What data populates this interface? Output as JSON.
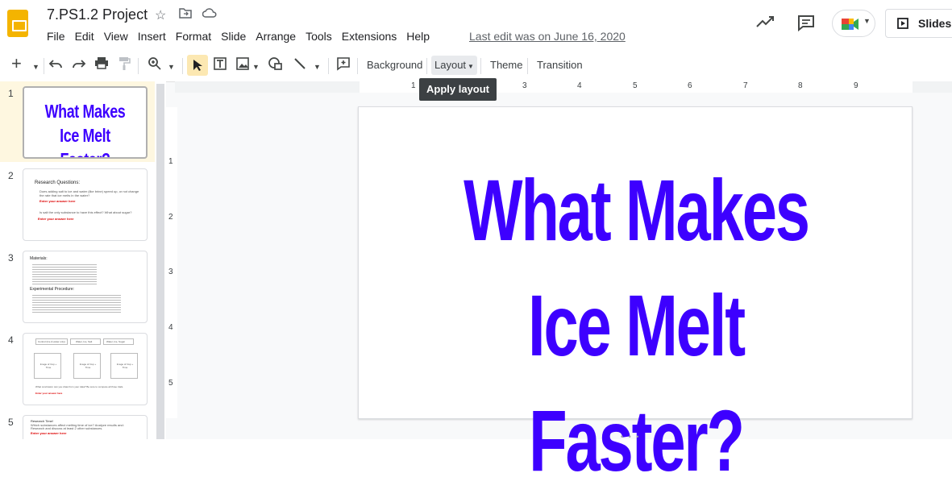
{
  "app": {
    "title": "7.PS1.2 Project",
    "last_edit": "Last edit was on June 16, 2020",
    "slideshow_label": "Slidesh",
    "accent_color": "#3d00ff"
  },
  "menu": [
    "File",
    "Edit",
    "View",
    "Insert",
    "Format",
    "Slide",
    "Arrange",
    "Tools",
    "Extensions",
    "Help"
  ],
  "toolbar": {
    "background_label": "Background",
    "layout_label": "Layout",
    "theme_label": "Theme",
    "transition_label": "Transition",
    "tooltip": "Apply layout",
    "icons": [
      "add-icon",
      "undo-icon",
      "redo-icon",
      "print-icon",
      "paint-format-icon",
      "zoom-icon",
      "select-icon",
      "text-box-icon",
      "image-icon",
      "shape-icon",
      "line-icon",
      "comment-add-icon"
    ]
  },
  "ruler": {
    "top": [
      "1",
      "3",
      "4",
      "5",
      "6",
      "7",
      "8",
      "9"
    ],
    "left": [
      "1",
      "2",
      "3",
      "4",
      "5"
    ]
  },
  "slides": [
    {
      "number": "1",
      "title": "What Makes\nIce Melt Faster?"
    },
    {
      "number": "2",
      "heading": "Research Questions:",
      "lines": [
        "Does adding salt to ice and water (like brine) speed up, or not change the rate that ice melts in the water?",
        "Enter your answer here",
        "Is salt the only substance to have this effect? What about sugar?",
        "Enter your answer here"
      ]
    },
    {
      "number": "3",
      "heading": "Materials:",
      "subheading": "Experimental Procedure:"
    },
    {
      "number": "4",
      "columns": [
        "Control (Ice & water only)",
        "Water, Ice, Salt",
        "Water, Ice, Sugar"
      ],
      "box_label": "Image of Cup + Time",
      "footer": "What conclusion can you draw from your data? Be sure to compare all three trials.",
      "answer": "Enter your answer here"
    },
    {
      "number": "5",
      "heading": "Research Time!",
      "lines": [
        "Which substances affect melting time of ice? Analyze results and:",
        "Research and discuss at least 2 other substances."
      ],
      "answer": "Enter your answer here"
    }
  ],
  "main_slide": {
    "title": "What Makes\nIce Melt Faster?"
  }
}
